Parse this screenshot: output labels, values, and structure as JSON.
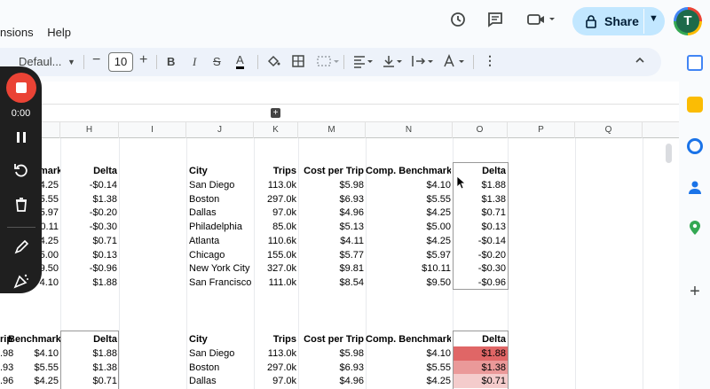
{
  "menu": {
    "items": [
      "nsions",
      "Help"
    ]
  },
  "toolbar": {
    "font_family": "Defaul...",
    "font_size": "10",
    "bold": "B",
    "italic": "I",
    "strike": "S",
    "text_color": "A",
    "minus": "−",
    "plus": "+"
  },
  "share": {
    "label": "Share"
  },
  "avatar": {
    "initial": "T"
  },
  "recorder": {
    "time": "0:00"
  },
  "colors": {
    "accent": "#c2e7ff",
    "record": "#ea4335",
    "heat1": "#e06666",
    "heat2": "#ea9999",
    "heat3": "#f4cccc"
  },
  "columns": [
    "H",
    "I",
    "J",
    "K",
    "M",
    "N",
    "O",
    "P",
    "Q"
  ],
  "table1": {
    "headers": {
      "city": "City",
      "trips": "Trips",
      "cost": "Cost per Trip",
      "bench": "Comp. Benchmark",
      "delta": "Delta"
    },
    "rows": [
      {
        "city": "San Diego",
        "trips": "113.0k",
        "cost": "$5.98",
        "bench": "$4.10",
        "delta": "$1.88"
      },
      {
        "city": "Boston",
        "trips": "297.0k",
        "cost": "$6.93",
        "bench": "$5.55",
        "delta": "$1.38"
      },
      {
        "city": "Dallas",
        "trips": "97.0k",
        "cost": "$4.96",
        "bench": "$4.25",
        "delta": "$0.71"
      },
      {
        "city": "Philadelphia",
        "trips": "85.0k",
        "cost": "$5.13",
        "bench": "$5.00",
        "delta": "$0.13"
      },
      {
        "city": "Atlanta",
        "trips": "110.6k",
        "cost": "$4.11",
        "bench": "$4.25",
        "delta": "-$0.14"
      },
      {
        "city": "Chicago",
        "trips": "155.0k",
        "cost": "$5.77",
        "bench": "$5.97",
        "delta": "-$0.20"
      },
      {
        "city": "New York City",
        "trips": "327.0k",
        "cost": "$9.81",
        "bench": "$10.11",
        "delta": "-$0.30"
      },
      {
        "city": "San Francisco",
        "trips": "111.0k",
        "cost": "$8.54",
        "bench": "$9.50",
        "delta": "-$0.96"
      }
    ]
  },
  "left1": {
    "header_partial": "mark",
    "header_delta": "Delta",
    "rows": [
      {
        "g": "4.25",
        "h": "-$0.14"
      },
      {
        "g": "5.55",
        "h": "$1.38"
      },
      {
        "g": "5.97",
        "h": "-$0.20"
      },
      {
        "g": "0.11",
        "h": "-$0.30"
      },
      {
        "g": "4.25",
        "h": "$0.71"
      },
      {
        "g": "5.00",
        "h": "$0.13"
      },
      {
        "g": "9.50",
        "h": "-$0.96"
      },
      {
        "g": "4.10",
        "h": "$1.88"
      }
    ]
  },
  "table2": {
    "headers": {
      "city": "City",
      "trips": "Trips",
      "cost": "Cost per Trip",
      "bench": "Comp. Benchmark",
      "delta": "Delta"
    },
    "rows": [
      {
        "city": "San Diego",
        "trips": "113.0k",
        "cost": "$5.98",
        "bench": "$4.10",
        "delta": "$1.88"
      },
      {
        "city": "Boston",
        "trips": "297.0k",
        "cost": "$6.93",
        "bench": "$5.55",
        "delta": "$1.38"
      },
      {
        "city": "Dallas",
        "trips": "97.0k",
        "cost": "$4.96",
        "bench": "$4.25",
        "delta": "$0.71"
      }
    ]
  },
  "left2": {
    "header_trip": "rip",
    "header_bench": "Benchmark",
    "header_delta": "Delta",
    "rows": [
      {
        "f": ".98",
        "g": "$4.10",
        "h": "$1.88"
      },
      {
        "f": ".93",
        "g": "$5.55",
        "h": "$1.38"
      },
      {
        "f": ".96",
        "g": "$4.25",
        "h": "$0.71"
      }
    ]
  }
}
